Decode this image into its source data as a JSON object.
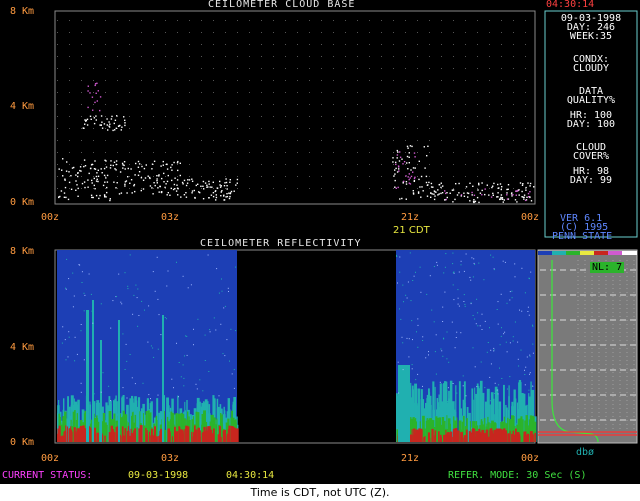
{
  "clock_time": "04:30:14",
  "cloud_base": {
    "title": "CEILOMETER CLOUD BASE",
    "y_ticks": [
      "8 Km",
      "4 Km",
      "0 Km"
    ],
    "x_ticks": [
      "00z",
      "03z",
      "21z",
      "00z"
    ],
    "annotation": "21 CDT"
  },
  "reflectivity": {
    "title": "CEILOMETER REFLECTIVITY",
    "y_ticks": [
      "8 Km",
      "4 Km",
      "0 Km"
    ],
    "x_ticks": [
      "00z",
      "03z",
      "21z",
      "00z"
    ]
  },
  "info": {
    "date": "09-03-1998",
    "day_line": "DAY: 246",
    "week_line": "WEEK:35",
    "condx_label": "CONDX:",
    "condx_value": "CLOUDY",
    "data_label": "DATA",
    "quality_label": "QUALITY%",
    "quality_hr": "HR: 100",
    "quality_day": "DAY: 100",
    "cloud_label": "CLOUD",
    "cover_label": "COVER%",
    "cover_hr": "HR: 98",
    "cover_day": "DAY: 99"
  },
  "version": {
    "line1": "VER 6.1",
    "line2": "(C) 1995",
    "line3": "PENN STATE"
  },
  "profile": {
    "nl_label": "NL: 7",
    "unit_label": "dbø"
  },
  "status_bar": {
    "current_status_label": "CURRENT STATUS:",
    "date": "09-03-1998",
    "time": "04:30:14",
    "mode_label": "REFER. MODE: 30 Sec (S)"
  },
  "caption": "Time is CDT, not UTC (Z).",
  "colors": {
    "background": "#000000",
    "tick_orange": "#ff9b40",
    "reflectivity_blue": "#1d3fb5",
    "cyan": "#20b0b0",
    "green": "#2bb32b",
    "red": "#c8261e",
    "magenta": "#d05ad0",
    "status_magenta": "#ff40ff",
    "status_yellow": "#e8e840",
    "mode_green": "#40e040"
  }
}
